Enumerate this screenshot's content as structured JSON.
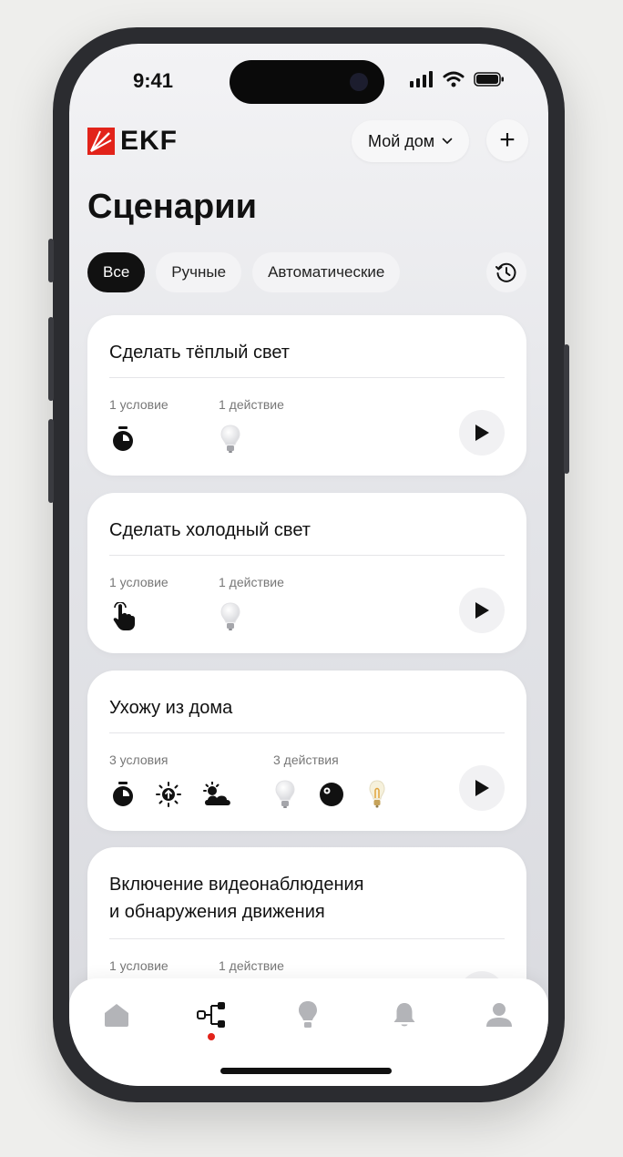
{
  "status_bar": {
    "time": "9:41"
  },
  "header": {
    "brand": "EKF",
    "home_selector": "Мой дом",
    "add_label": "+"
  },
  "page": {
    "title": "Сценарии"
  },
  "filters": [
    {
      "label": "Все",
      "active": true
    },
    {
      "label": "Ручные",
      "active": false
    },
    {
      "label": "Автоматические",
      "active": false
    }
  ],
  "scenarios": [
    {
      "name_line1": "Сделать тёплый свет",
      "name_line2": "",
      "conditions_label": "1 условие",
      "actions_label": "1 действие",
      "condition_icons": [
        "timer-icon"
      ],
      "action_icons": [
        "bulb-icon"
      ]
    },
    {
      "name_line1": "Сделать холодный свет",
      "name_line2": "",
      "conditions_label": "1 условие",
      "actions_label": "1 действие",
      "condition_icons": [
        "tap-hand-icon"
      ],
      "action_icons": [
        "bulb-icon"
      ]
    },
    {
      "name_line1": "Ухожу из дома",
      "name_line2": "",
      "conditions_label": "3 условия",
      "actions_label": "3 действия",
      "condition_icons": [
        "timer-icon",
        "sunrise-icon",
        "weather-icon"
      ],
      "action_icons": [
        "bulb-icon",
        "smart-speaker-icon",
        "filament-bulb-icon"
      ]
    },
    {
      "name_line1": "Включение видеонаблюдения",
      "name_line2": "и обнаружения движения",
      "conditions_label": "1 условие",
      "actions_label": "1 действие",
      "condition_icons": [],
      "action_icons": []
    }
  ],
  "tabbar": {
    "items": [
      "home-icon",
      "scenarios-icon",
      "devices-icon",
      "notifications-icon",
      "profile-icon"
    ],
    "active_index": 1
  },
  "colors": {
    "brand_red": "#e2231a",
    "dark": "#111111"
  }
}
